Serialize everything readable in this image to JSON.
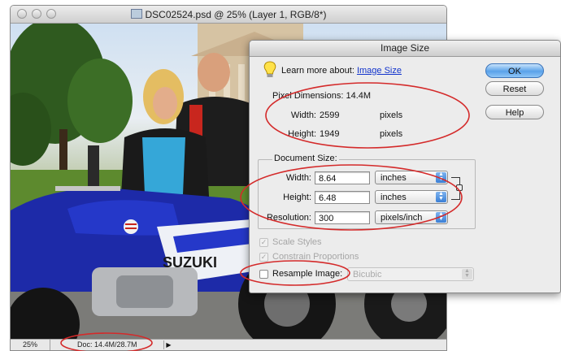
{
  "document_window": {
    "title": "DSC02524.psd @ 25% (Layer 1, RGB/8*)",
    "status": {
      "zoom": "25%",
      "doc_info": "Doc: 14.4M/28.7M"
    },
    "photo_text": {
      "brand": "SUZUKI"
    }
  },
  "dialog": {
    "title": "Image Size",
    "learn_more": {
      "label": "Learn more about:",
      "link": "Image Size"
    },
    "pixel_dimensions": {
      "label": "Pixel Dimensions:",
      "size": "14.4M",
      "width": {
        "label": "Width:",
        "value": "2599",
        "unit": "pixels"
      },
      "height": {
        "label": "Height:",
        "value": "1949",
        "unit": "pixels"
      }
    },
    "document_size": {
      "label": "Document Size:",
      "width": {
        "label": "Width:",
        "value": "8.64",
        "unit": "inches"
      },
      "height": {
        "label": "Height:",
        "value": "6.48",
        "unit": "inches"
      },
      "resolution": {
        "label": "Resolution:",
        "value": "300",
        "unit": "pixels/inch"
      }
    },
    "options": {
      "scale_styles": {
        "label": "Scale Styles",
        "checked": true,
        "enabled": false
      },
      "constrain_proportions": {
        "label": "Constrain Proportions",
        "checked": true,
        "enabled": false
      },
      "resample_image": {
        "label": "Resample Image:",
        "checked": false,
        "enabled": true
      },
      "resample_method": "Bicubic"
    },
    "buttons": {
      "ok": "OK",
      "reset": "Reset",
      "help": "Help"
    }
  },
  "colors": {
    "annotation": "#d42a2a",
    "default_button": "#5aa2ea",
    "link": "#1133cc"
  },
  "icons": [
    "lightbulb-icon",
    "chain-link-icon",
    "popup-arrows-icon",
    "status-arrow-icon"
  ]
}
